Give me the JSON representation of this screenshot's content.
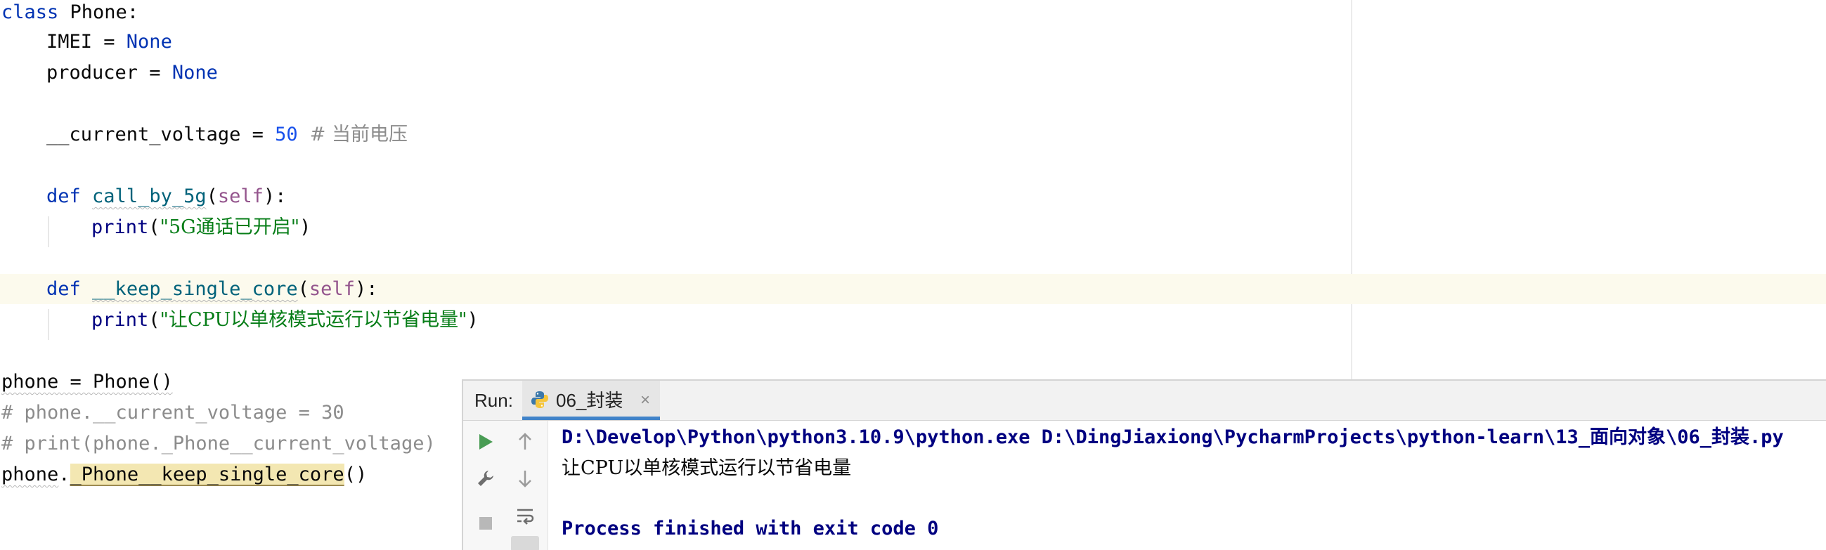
{
  "editor": {
    "line1": {
      "kw": "class",
      "name": " Phone:"
    },
    "line2": {
      "name": "IMEI = ",
      "val": "None"
    },
    "line3": {
      "name": "producer = ",
      "val": "None"
    },
    "line5": {
      "name": "__current_voltage = ",
      "num": "50",
      "comment": "  # 当前电压"
    },
    "line7": {
      "kw": "def",
      "fn": "call_by_5g",
      "open": "(",
      "self": "self",
      "close": "):"
    },
    "line8": {
      "fn": "print",
      "open": "(",
      "str": "\"5G通话已开启\"",
      "close": ")"
    },
    "line10": {
      "kw": "def",
      "fn": "__keep_single_core",
      "open": "(",
      "self": "self",
      "close": "):"
    },
    "line11": {
      "fn": "print",
      "open": "(",
      "str": "\"让CPU以单核模式运行以节省电量\"",
      "close": ")"
    },
    "line13": {
      "text": "phone = Phone()"
    },
    "line14": {
      "comment": "# phone.__current_voltage = 30"
    },
    "line15": {
      "comment": "# print(phone._Phone__current_voltage)"
    },
    "line16": {
      "obj": "phone",
      "dot": ".",
      "call": "_Phone__keep_single_core",
      "paren": "()"
    }
  },
  "run_panel": {
    "label": "Run:",
    "tab": {
      "title": "06_封装",
      "close": "×",
      "icon": "python-icon"
    },
    "toolbar": [
      "rerun-icon",
      "arrow-up-icon",
      "wrench-icon",
      "arrow-down-icon",
      "stop-icon",
      "soft-wrap-icon"
    ],
    "console": {
      "command": "D:\\Develop\\Python\\python3.10.9\\python.exe D:\\DingJiaxiong\\PycharmProjects\\python-learn\\13_面向对象\\06_封装.py",
      "output": "让CPU以单核模式运行以节省电量",
      "exit": "Process finished with exit code 0"
    }
  },
  "colors": {
    "keyword": "#0033b3",
    "number": "#1750eb",
    "self": "#94558d",
    "function": "#00627a",
    "string": "#067d17",
    "comment": "#8c8c8c",
    "builtin": "#000080",
    "caret_row": "#fcfaed",
    "highlight": "#f3e7b2",
    "tab_underline": "#4083c9",
    "run_green": "#499c54"
  }
}
